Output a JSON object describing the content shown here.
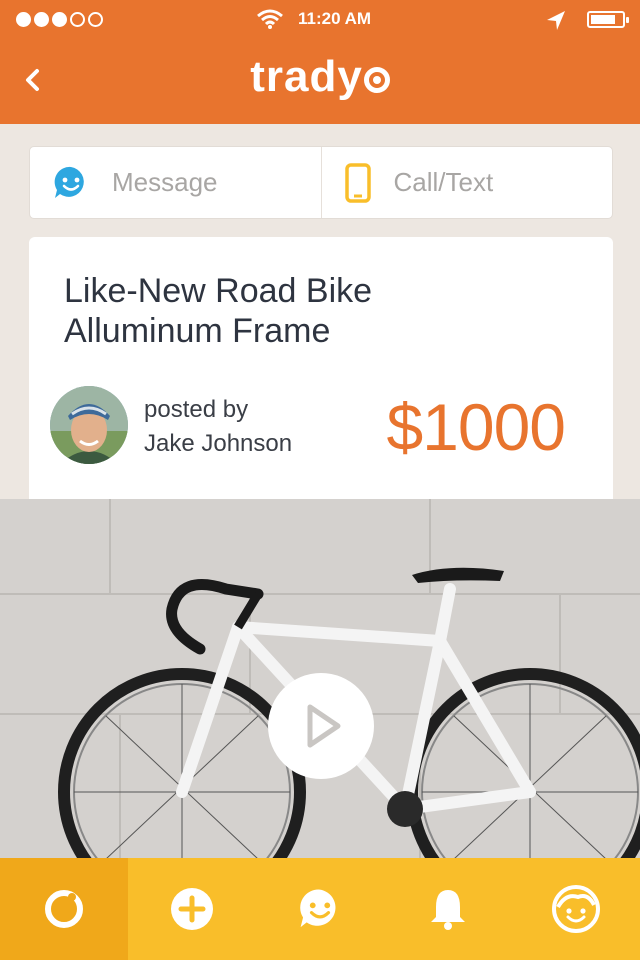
{
  "status_bar": {
    "signal_bars_filled": 3,
    "signal_bars_total": 5,
    "time": "11:20 AM"
  },
  "header": {
    "logo_text": "trady",
    "back_icon": "chevron-left-icon"
  },
  "contact": {
    "message_label": "Message",
    "call_label": "Call/Text",
    "message_icon": "chat-smiley-icon",
    "call_icon": "phone-icon"
  },
  "listing": {
    "title_line1": "Like-New Road Bike",
    "title_line2": "Alluminum Frame",
    "posted_by_label": "posted by",
    "seller_name": "Jake Johnson",
    "price": "$1000"
  },
  "tabs": [
    {
      "icon": "refresh-ring-icon",
      "active": true
    },
    {
      "icon": "plus-circle-icon",
      "active": false
    },
    {
      "icon": "chat-smiley-icon",
      "active": false
    },
    {
      "icon": "bell-icon",
      "active": false
    },
    {
      "icon": "face-icon",
      "active": false
    }
  ],
  "colors": {
    "header": "#E8742E",
    "accent_price": "#E8742E",
    "tabbar": "#F9BE2A",
    "tab_active": "#F0A81A",
    "message_icon": "#2EA7E0",
    "call_icon": "#F9BE2A"
  }
}
